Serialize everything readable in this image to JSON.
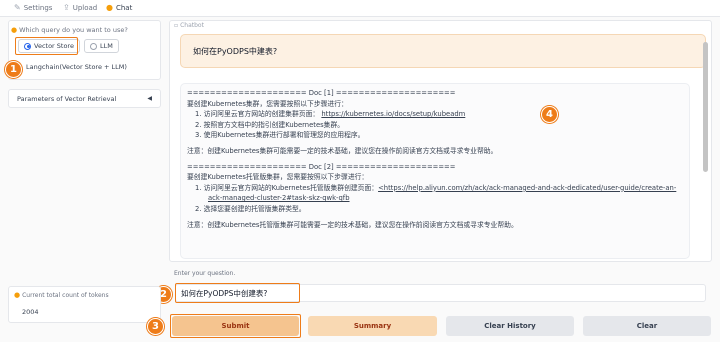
{
  "tabs": [
    {
      "label": "Settings",
      "icon": "wrench-icon"
    },
    {
      "label": "Upload",
      "icon": "upload-icon"
    },
    {
      "label": "Chat",
      "icon": "chat-icon"
    }
  ],
  "query": {
    "label": "Which query do you want to use?",
    "options": [
      "Vector Store",
      "LLM",
      "Langchain(Vector Store + LLM)"
    ],
    "selected": "Vector Store"
  },
  "params": {
    "label": "Parameters of Vector Retrieval",
    "caret": "◀"
  },
  "chatbot": {
    "label": "Chatbot",
    "user_message": "如何在PyODPS中建表?",
    "lines": [
      "===================== Doc [1] =====================",
      "要创建Kubernetes集群，您需要按照以下步骤进行：",
      "1. 访问阿里云官方网站的创建集群页面：",
      "https://kubernetes.io/docs/setup/kubeadm",
      "2. 按照官方文档中的指引创建Kubernetes集群。",
      "3. 使用Kubernetes集群进行部署和管理您的应用程序。",
      "注意：创建Kubernetes集群可能需要一定的技术基础，建议您在操作前阅读官方文档或寻求专业帮助。",
      "===================== Doc [2] =====================",
      "要创建Kubernetes托管版集群，您需要按照以下步骤进行：",
      "1. 访问阿里云官方网站的Kubernetes托管版集群创建页面：",
      "<https://help.aliyun.com/zh/ack/ack-managed-and-ack-dedicated/user-guide/create-an-",
      "ack-managed-cluster-2#task-skz-qwk-qfb",
      "2. 选择您要创建的托管版集群类型。",
      "注意：创建Kubernetes托管版集群可能需要一定的技术基础，建议您在操作前阅读官方文档或寻求专业帮助。"
    ]
  },
  "input": {
    "label": "Enter your question.",
    "value": "如何在PyODPS中创建表?"
  },
  "tokens": {
    "label": "Current total count of tokens",
    "value": "2004"
  },
  "buttons": {
    "submit": "Submit",
    "summary": "Summary",
    "clear_history": "Clear History",
    "clear": "Clear"
  },
  "markers": [
    "1",
    "2",
    "3",
    "4"
  ],
  "colors": {
    "accent": "#ee7c19",
    "submit_bg": "#f5c48f",
    "summary_bg": "#f9d9b3",
    "neutral_btn": "#e5e7eb",
    "user_bubble": "#fdf1e3"
  }
}
